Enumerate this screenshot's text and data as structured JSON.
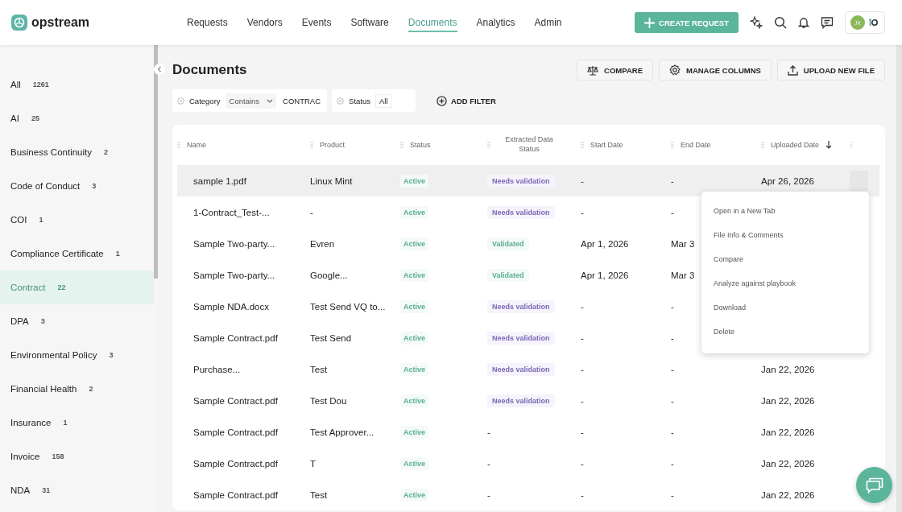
{
  "brand": {
    "name": "opstream"
  },
  "nav": [
    {
      "label": "Requests",
      "selected": false
    },
    {
      "label": "Vendors",
      "selected": false
    },
    {
      "label": "Events",
      "selected": false
    },
    {
      "label": "Software",
      "selected": false
    },
    {
      "label": "Documents",
      "selected": true
    },
    {
      "label": "Analytics",
      "selected": false
    },
    {
      "label": "Admin",
      "selected": false
    }
  ],
  "create_button": "CREATE REQUEST",
  "avatar": {
    "initials": "JK"
  },
  "sidebar": {
    "items": [
      {
        "label": "All",
        "count": "1261",
        "selected": false
      },
      {
        "label": "AI",
        "count": "25",
        "selected": false
      },
      {
        "label": "Business Continuity",
        "count": "2",
        "selected": false
      },
      {
        "label": "Code of Conduct",
        "count": "3",
        "selected": false
      },
      {
        "label": "COI",
        "count": "1",
        "selected": false
      },
      {
        "label": "Compliance Certificate",
        "count": "1",
        "selected": false
      },
      {
        "label": "Contract",
        "count": "22",
        "selected": true
      },
      {
        "label": "DPA",
        "count": "3",
        "selected": false
      },
      {
        "label": "Environmental Policy",
        "count": "3",
        "selected": false
      },
      {
        "label": "Financial Health",
        "count": "2",
        "selected": false
      },
      {
        "label": "Insurance",
        "count": "1",
        "selected": false
      },
      {
        "label": "Invoice",
        "count": "158",
        "selected": false
      },
      {
        "label": "NDA",
        "count": "31",
        "selected": false
      }
    ]
  },
  "page_title": "Documents",
  "actions": [
    {
      "kind": "compare",
      "label": "COMPARE"
    },
    {
      "kind": "columns",
      "label": "MANAGE COLUMNS"
    },
    {
      "kind": "upload",
      "label": "UPLOAD NEW FILE"
    }
  ],
  "filters": [
    {
      "kind": "select",
      "label": "Category",
      "operator": "Contains",
      "value": "CONTRAC"
    },
    {
      "kind": "chip",
      "label": "Status",
      "value": "All"
    }
  ],
  "add_filter": "ADD FILTER",
  "table": {
    "columns": [
      {
        "label": "Name",
        "sorted": false
      },
      {
        "label": "Product",
        "sorted": false
      },
      {
        "label": "Status",
        "sorted": false
      },
      {
        "label": "Extracted Data Status",
        "sorted": false
      },
      {
        "label": "Start Date",
        "sorted": false
      },
      {
        "label": "End Date",
        "sorted": false
      },
      {
        "label": "Uploaded Date",
        "sorted": true
      }
    ],
    "rows": [
      {
        "name": "sample 1.pdf",
        "product": "Linux Mint",
        "status": "Active",
        "extracted": {
          "kind": "needs",
          "label": "Needs validation"
        },
        "start": "-",
        "end": "-",
        "uploaded": "Apr 26, 2026",
        "selected": true
      },
      {
        "name": "1-Contract_Test-...",
        "product": "-",
        "status": "Active",
        "extracted": {
          "kind": "needs",
          "label": "Needs validation"
        },
        "start": "-",
        "end": "-",
        "selected": false
      },
      {
        "name": "Sample Two-party...",
        "product": "Evren",
        "status": "Active",
        "extracted": {
          "kind": "validated",
          "label": "Validated"
        },
        "start": "Apr 1, 2026",
        "end": "Mar 3",
        "selected": false
      },
      {
        "name": "Sample Two-party...",
        "product": "Google...",
        "status": "Active",
        "extracted": {
          "kind": "validated",
          "label": "Validated"
        },
        "start": "Apr 1, 2026",
        "end": "Mar 3",
        "selected": false
      },
      {
        "name": "Sample NDA.docx",
        "product": "Test Send VQ to...",
        "status": "Active",
        "extracted": {
          "kind": "needs",
          "label": "Needs validation"
        },
        "start": "-",
        "end": "-",
        "selected": false
      },
      {
        "name": "Sample Contract.pdf",
        "product": "Test Send",
        "status": "Active",
        "extracted": {
          "kind": "needs",
          "label": "Needs validation"
        },
        "start": "-",
        "end": "-",
        "selected": false
      },
      {
        "name": "Purchase...",
        "product": "Test",
        "status": "Active",
        "extracted": {
          "kind": "needs",
          "label": "Needs validation"
        },
        "start": "-",
        "end": "-",
        "uploaded": "Jan 22, 2026",
        "selected": false
      },
      {
        "name": "Sample Contract.pdf",
        "product": "Test Dou",
        "status": "Active",
        "extracted": {
          "kind": "needs",
          "label": "Needs validation"
        },
        "start": "-",
        "end": "-",
        "uploaded": "Jan 22, 2026",
        "selected": false
      },
      {
        "name": "Sample Contract.pdf",
        "product": "Test Approver...",
        "status": "Active",
        "extracted": {
          "kind": "none",
          "label": "-"
        },
        "start": "-",
        "end": "-",
        "uploaded": "Jan 22, 2026",
        "selected": false
      },
      {
        "name": "Sample Contract.pdf",
        "product": "T",
        "status": "Active",
        "extracted": {
          "kind": "none",
          "label": "-"
        },
        "start": "-",
        "end": "-",
        "uploaded": "Jan 22, 2026",
        "selected": false
      },
      {
        "name": "Sample Contract.pdf",
        "product": "Test",
        "status": "Active",
        "extracted": {
          "kind": "none",
          "label": "-"
        },
        "start": "-",
        "end": "-",
        "uploaded": "Jan 22, 2026",
        "selected": false
      }
    ]
  },
  "context_menu": {
    "items": [
      "Open in a New Tab",
      "File Info & Comments",
      "Compare",
      "Analyze against playbook",
      "Download",
      "Delete"
    ]
  }
}
